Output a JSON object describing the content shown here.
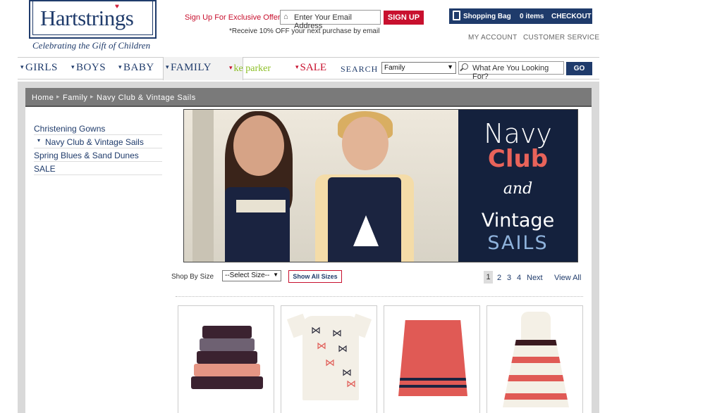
{
  "brand": {
    "logo": "Hartstrings",
    "tagline": "Celebrating the Gift of Children"
  },
  "header": {
    "signup_label": "Sign Up For Exclusive Offers:",
    "email_placeholder": "Enter Your Email Address",
    "signup_button": "SIGN UP",
    "signup_note": "*Receive 10% OFF your next purchase by email",
    "bag_label": "Shopping Bag",
    "bag_count": "0 items",
    "checkout": "CHECKOUT",
    "my_account": "MY ACCOUNT",
    "customer_service": "CUSTOMER SERVICE"
  },
  "nav": {
    "girls": "GIRLS",
    "boys": "BOYS",
    "baby": "BABY",
    "family": "FAMILY",
    "ke_parker": "ke parker",
    "sale": "SALE",
    "search_label": "SEARCH",
    "search_select": "Family",
    "search_placeholder": "What Are You Looking For?",
    "go": "GO"
  },
  "breadcrumb": [
    "Home",
    "Family",
    "Navy Club & Vintage Sails"
  ],
  "sidebar": {
    "items": [
      {
        "label": "Christening Gowns"
      },
      {
        "label": "Navy Club & Vintage Sails"
      },
      {
        "label": "Spring Blues & Sand Dunes"
      },
      {
        "label": "SALE"
      }
    ]
  },
  "banner": {
    "line1": "Navy",
    "line2": "Club",
    "line3": "and",
    "line4": "Vintage",
    "line5": "SAILS"
  },
  "filters": {
    "size_label": "Shop By Size",
    "size_select": "--Select Size--",
    "show_all": "Show All Sizes"
  },
  "pagination": {
    "pages": [
      "1",
      "2",
      "3",
      "4"
    ],
    "next": "Next",
    "view_all": "View All"
  },
  "colors": {
    "navy": "#1f3b6b",
    "red": "#c8102e",
    "green": "#8cbf26"
  }
}
